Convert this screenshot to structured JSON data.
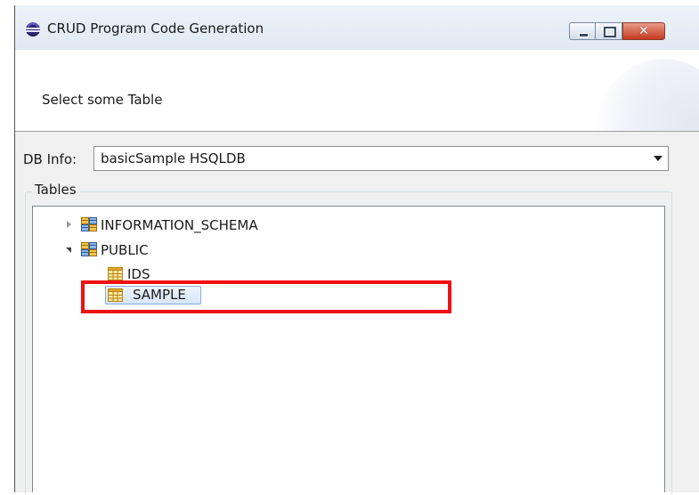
{
  "window": {
    "title": "CRUD Program Code Generation"
  },
  "banner": {
    "message": "Select some Table"
  },
  "db_info": {
    "label": "DB Info:",
    "selected": "basicSample HSQLDB"
  },
  "tables_group": {
    "label": "Tables",
    "tree": [
      {
        "label": "INFORMATION_SCHEMA",
        "type": "schema",
        "state": "collapsed"
      },
      {
        "label": "PUBLIC",
        "type": "schema",
        "state": "expanded",
        "children": [
          {
            "label": "IDS",
            "type": "table",
            "selected": false
          },
          {
            "label": "SAMPLE",
            "type": "table",
            "selected": true
          }
        ]
      }
    ]
  },
  "colors": {
    "annotation_highlight": "#ee1111",
    "selection_border": "#84acdd",
    "selection_fill": "#d6e6fb"
  }
}
